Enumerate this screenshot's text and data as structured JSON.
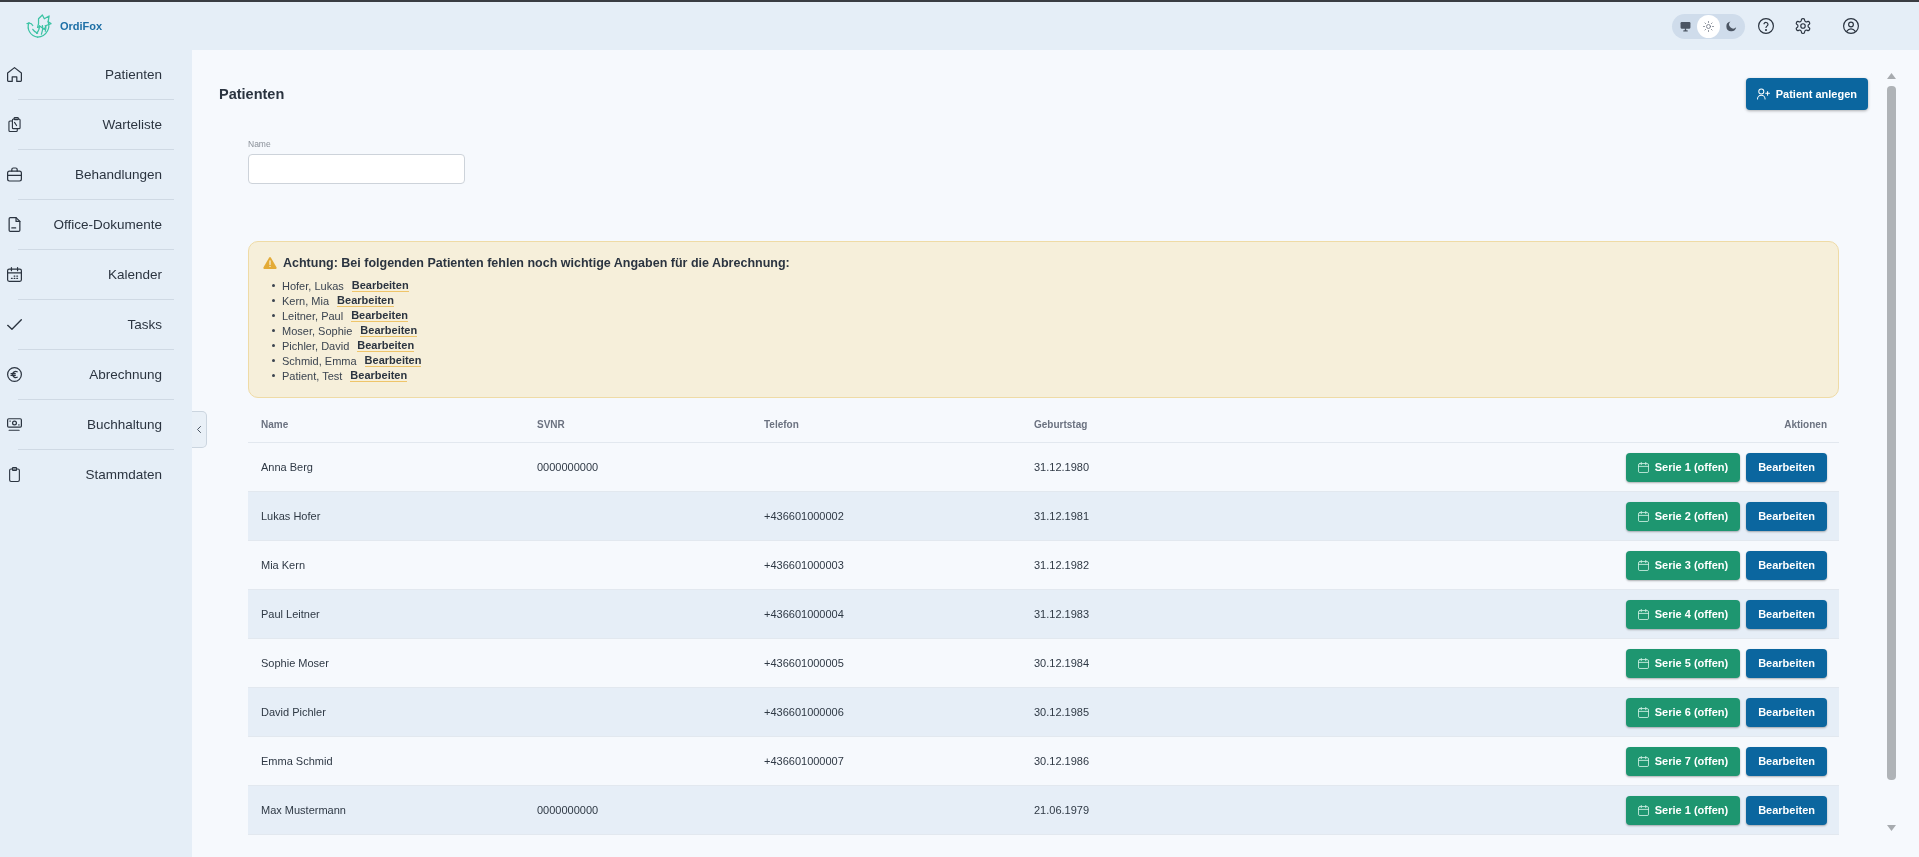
{
  "header": {
    "app_name": "OrdiFox",
    "theme_options": [
      {
        "kind": "system",
        "selected": false
      },
      {
        "kind": "light",
        "selected": true
      },
      {
        "kind": "dark",
        "selected": false
      }
    ]
  },
  "sidebar": {
    "items": [
      {
        "label": "Patienten"
      },
      {
        "label": "Warteliste"
      },
      {
        "label": "Behandlungen"
      },
      {
        "label": "Office-Dokumente"
      },
      {
        "label": "Kalender"
      },
      {
        "label": "Tasks"
      },
      {
        "label": "Abrechnung"
      },
      {
        "label": "Buchhaltung"
      },
      {
        "label": "Stammdaten"
      }
    ]
  },
  "page": {
    "title": "Patienten",
    "add_button": "Patient anlegen",
    "name_filter": {
      "label": "Name"
    }
  },
  "warning": {
    "title": "Achtung: Bei folgenden Patienten fehlen noch wichtige Angaben für die Abrechnung:",
    "items": [
      {
        "name": "Hofer, Lukas",
        "action": "Bearbeiten"
      },
      {
        "name": "Kern, Mia",
        "action": "Bearbeiten"
      },
      {
        "name": "Leitner, Paul",
        "action": "Bearbeiten"
      },
      {
        "name": "Moser, Sophie",
        "action": "Bearbeiten"
      },
      {
        "name": "Pichler, David",
        "action": "Bearbeiten"
      },
      {
        "name": "Schmid, Emma",
        "action": "Bearbeiten"
      },
      {
        "name": "Patient, Test",
        "action": "Bearbeiten"
      }
    ]
  },
  "table": {
    "columns": [
      "Name",
      "SVNR",
      "Telefon",
      "Geburtstag",
      "Aktionen"
    ],
    "rows": [
      {
        "name": "Anna Berg",
        "svnr": "0000000000",
        "birthday": "31.12.1980",
        "actions": [
          {
            "kind": "series",
            "label": "Serie 1 (offen)"
          },
          {
            "kind": "edit",
            "label": "Bearbeiten"
          }
        ]
      },
      {
        "name": "Lukas Hofer",
        "phone": "+436601000002",
        "birthday": "31.12.1981",
        "actions": [
          {
            "kind": "series",
            "label": "Serie 2 (offen)"
          },
          {
            "kind": "edit",
            "label": "Bearbeiten"
          }
        ]
      },
      {
        "name": "Mia Kern",
        "phone": "+436601000003",
        "birthday": "31.12.1982",
        "actions": [
          {
            "kind": "series",
            "label": "Serie 3 (offen)"
          },
          {
            "kind": "edit",
            "label": "Bearbeiten"
          }
        ]
      },
      {
        "name": "Paul Leitner",
        "phone": "+436601000004",
        "birthday": "31.12.1983",
        "actions": [
          {
            "kind": "series",
            "label": "Serie 4 (offen)"
          },
          {
            "kind": "edit",
            "label": "Bearbeiten"
          }
        ]
      },
      {
        "name": "Sophie Moser",
        "phone": "+436601000005",
        "birthday": "30.12.1984",
        "actions": [
          {
            "kind": "series",
            "label": "Serie 5 (offen)"
          },
          {
            "kind": "edit",
            "label": "Bearbeiten"
          }
        ]
      },
      {
        "name": "David Pichler",
        "phone": "+436601000006",
        "birthday": "30.12.1985",
        "actions": [
          {
            "kind": "series",
            "label": "Serie 6 (offen)"
          },
          {
            "kind": "edit",
            "label": "Bearbeiten"
          }
        ]
      },
      {
        "name": "Emma Schmid",
        "phone": "+436601000007",
        "birthday": "30.12.1986",
        "actions": [
          {
            "kind": "series",
            "label": "Serie 7 (offen)"
          },
          {
            "kind": "edit",
            "label": "Bearbeiten"
          }
        ]
      },
      {
        "name": "Max Mustermann",
        "svnr": "0000000000",
        "birthday": "21.06.1979",
        "actions": [
          {
            "kind": "series",
            "label": "Serie 1 (offen)"
          },
          {
            "kind": "edit",
            "label": "Bearbeiten"
          }
        ]
      }
    ]
  }
}
